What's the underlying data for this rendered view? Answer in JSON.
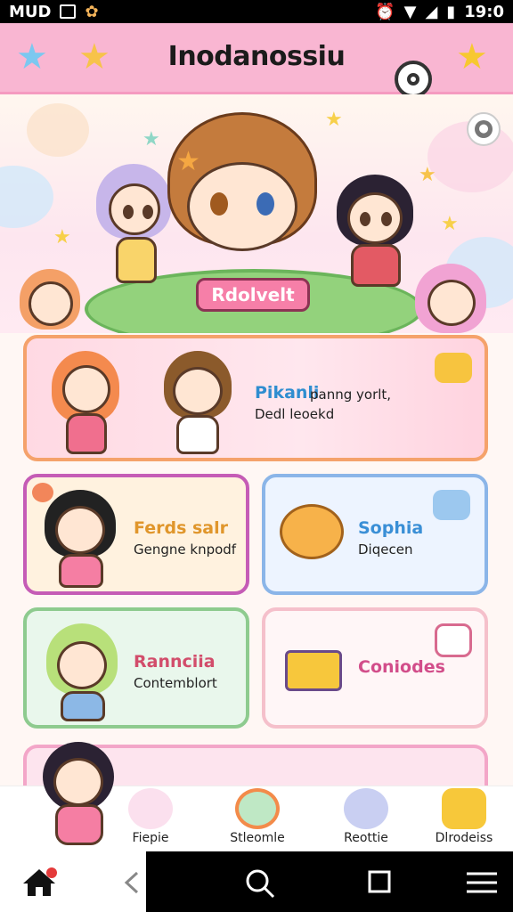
{
  "status_bar": {
    "carrier": "MUD",
    "time": "19:0"
  },
  "header": {
    "title": "Inodanossiu"
  },
  "hero": {
    "sign_text": "Rdolvelt"
  },
  "cards": {
    "feature": {
      "title": "Pikanli",
      "subtitle_1": "panng yorlt,",
      "subtitle_2": "Dedl leoekd"
    },
    "events": {
      "title": "Ferds salr",
      "subtitle": "Gengne knpodf"
    },
    "sophia": {
      "title": "Sophia",
      "subtitle": "Diqecen"
    },
    "rank": {
      "title": "Rannciia",
      "subtitle": "Contemblort"
    },
    "codes": {
      "title": "Coniodes"
    }
  },
  "bottom_tabs": [
    {
      "label": "Fiepie",
      "icon": "cat-icon"
    },
    {
      "label": "Stleomle",
      "icon": "rainbow-icon"
    },
    {
      "label": "Reottie",
      "icon": "cat-face-icon"
    },
    {
      "label": "Dlrodeiss",
      "icon": "heart-balloon-icon"
    }
  ],
  "colors": {
    "header_pink": "#f9b6d2",
    "feature_border": "#f5a26b",
    "events_title": "#e0962b",
    "sophia_title": "#3a8fd6",
    "rank_title": "#d24d6b",
    "codes_title": "#d24d8a"
  }
}
